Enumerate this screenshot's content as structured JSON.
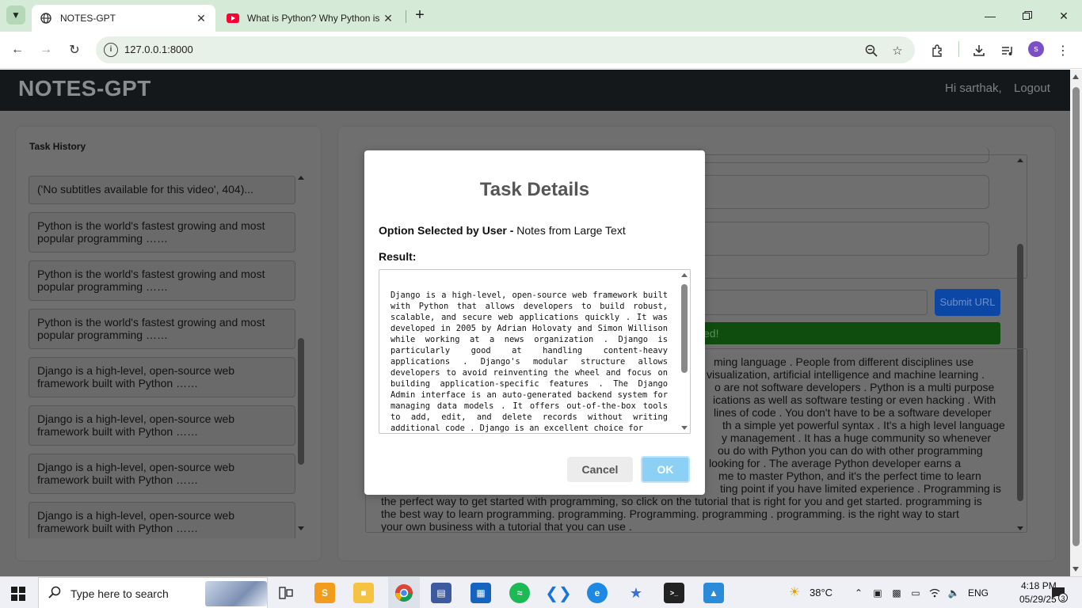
{
  "browser": {
    "tabs": [
      {
        "title": "NOTES-GPT",
        "active": true
      },
      {
        "title": "What is Python? Why Python is",
        "active": false
      }
    ],
    "url": "127.0.0.1:8000",
    "profile_initial": "s"
  },
  "navbar": {
    "brand": "NOTES-GPT",
    "greeting": "Hi sarthak,",
    "logout": "Logout"
  },
  "sidebar": {
    "title": "Task History",
    "items": [
      "('No subtitles available for this video', 404)...",
      "Python is the world's fastest growing and most popular programming ……",
      "Python is the world's fastest growing and most popular programming ……",
      "Python is the world's fastest growing and most popular programming ……",
      "Django is a high-level, open-source web framework built with Python ……",
      "Django is a high-level, open-source web framework built with Python ……",
      "Django is a high-level, open-source web framework built with Python ……",
      "Django is a high-level, open-source web framework built with Python ……"
    ]
  },
  "main": {
    "submit_label": "Submit URL",
    "alert_text": "ed!",
    "output_lines": [
      "ming language . People from different disciplines use",
      "visualization, artificial intelligence and machine learning .",
      "o are not software developers . Python is a multi purpose",
      "ications as well as software testing or even hacking . With",
      "lines of code . You don't have to be a software developer",
      "th a simple yet powerful syntax . It's a high level language",
      "y management . It has a huge community so whenever",
      "ou do with Python you can do with other programming",
      "looking for . The average Python developer earns a",
      "me to master Python, and it's the perfect time to learn",
      "ting point if you have limited experience . Programming is",
      "the perfect way to get started with programming, so click on the tutorial that is right for you and get started. programming is",
      "the best way to learn programming. programming. Programming. programming . programming. is the right way to start",
      "your own business with a tutorial that you can use ."
    ]
  },
  "modal": {
    "title": "Task Details",
    "option_label": "Option Selected by User -",
    "option_value": "Notes from Large Text",
    "result_label": "Result:",
    "result_text": "Django is a high-level, open-source web framework built with Python that allows developers to build robust, scalable, and secure web applications quickly . It was developed in 2005 by Adrian Holovaty and Simon Willison while working at a news organization . Django is particularly good at handling content-heavy applications . Django's modular structure allows developers to avoid reinventing the wheel and focus on building application-specific features . The Django Admin interface is an auto-generated backend system for managing data models . It offers out-of-the-box tools to add, edit, and delete records without writing additional code . Django is an excellent choice for",
    "cancel_label": "Cancel",
    "ok_label": "OK"
  },
  "taskbar": {
    "search_placeholder": "Type here to search",
    "weather": "38°C",
    "language": "ENG",
    "time": "4:18 PM",
    "date": "05/29/25",
    "notification_count": "3"
  }
}
